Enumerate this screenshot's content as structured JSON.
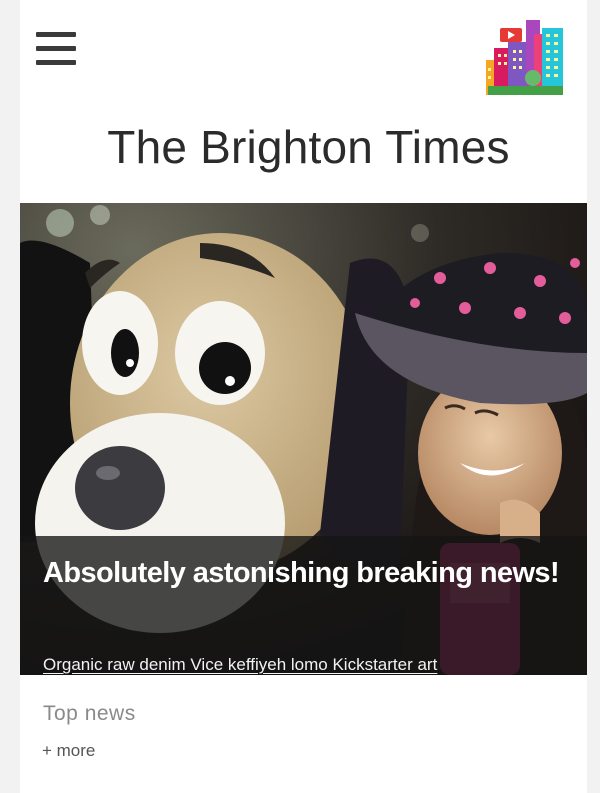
{
  "header": {
    "menu_icon": "hamburger-menu-icon",
    "logo_icon": "city-buildings-logo-icon",
    "masthead": "The Brighton Times"
  },
  "featured": {
    "image_subject": "mascot-dog-costume-and-woman-in-hat-photo",
    "headline": "Absolutely astonishing breaking news!",
    "summary": "Organic raw denim Vice keffiyeh lomo Kickstarter art"
  },
  "top_news": {
    "title": "Top news",
    "more_label": "+ more"
  },
  "colors": {
    "background": "#f2f2f2",
    "page": "#ffffff",
    "text_dark": "#2b2b2b",
    "caption_overlay": "#141414",
    "section_title": "#8a8a8a"
  }
}
